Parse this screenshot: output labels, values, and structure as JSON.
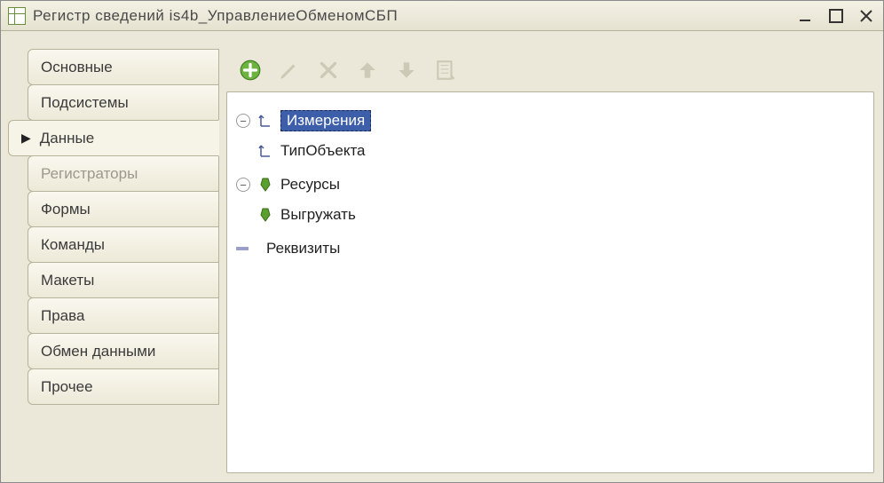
{
  "window": {
    "title": "Регистр сведений is4b_УправлениеОбменомСБП"
  },
  "sidebar": {
    "items": [
      {
        "label": "Основные",
        "active": false,
        "disabled": false
      },
      {
        "label": "Подсистемы",
        "active": false,
        "disabled": false
      },
      {
        "label": "Данные",
        "active": true,
        "disabled": false
      },
      {
        "label": "Регистраторы",
        "active": false,
        "disabled": true
      },
      {
        "label": "Формы",
        "active": false,
        "disabled": false
      },
      {
        "label": "Команды",
        "active": false,
        "disabled": false
      },
      {
        "label": "Макеты",
        "active": false,
        "disabled": false
      },
      {
        "label": "Права",
        "active": false,
        "disabled": false
      },
      {
        "label": "Обмен данными",
        "active": false,
        "disabled": false
      },
      {
        "label": "Прочее",
        "active": false,
        "disabled": false
      }
    ]
  },
  "toolbar": {
    "add": "add",
    "edit": "edit",
    "delete": "delete",
    "up": "move-up",
    "down": "move-down",
    "props": "properties"
  },
  "tree": {
    "dimensions": {
      "label": "Измерения",
      "selected": true,
      "expanded": true,
      "children": [
        {
          "label": "ТипОбъекта"
        }
      ]
    },
    "resources": {
      "label": "Ресурсы",
      "expanded": true,
      "children": [
        {
          "label": "Выгружать"
        }
      ]
    },
    "attributes": {
      "label": "Реквизиты",
      "expanded": false,
      "children": []
    }
  }
}
